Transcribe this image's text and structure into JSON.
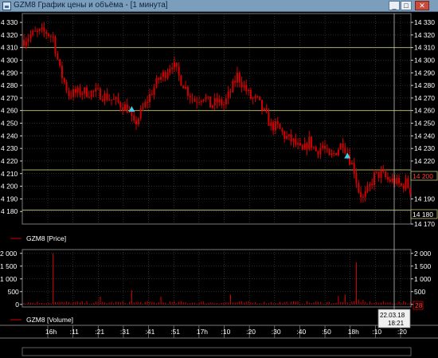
{
  "window": {
    "title": "GZM8 График цены и объёма - [1 минута]",
    "controls": {
      "minimize": "_",
      "maximize": "□",
      "close": "✕"
    }
  },
  "colors": {
    "background": "#000000",
    "candle": "#d40000",
    "grid": "#5a5a5a",
    "level_line": "#c8c878",
    "crosshair": "#c0c0c0",
    "marker": "#3cd0e6",
    "price_box_text": "#ff3a3a"
  },
  "price_panel": {
    "legend": "GZM8 [Price]",
    "left_ticks": [
      "4 330",
      "4 320",
      "4 310",
      "4 300",
      "4 290",
      "4 280",
      "4 270",
      "4 260",
      "4 250",
      "4 240",
      "4 230",
      "4 220",
      "4 210",
      "4 200",
      "4 190",
      "4 180"
    ],
    "right_ticks": [
      "14 330",
      "14 320",
      "14 310",
      "14 300",
      "14 290",
      "14 280",
      "14 270",
      "14 260",
      "14 250",
      "14 240",
      "14 230",
      "14 220",
      "14 210",
      "14 190",
      "14 170"
    ],
    "current_price_label": "14 200",
    "level_label": "14 180"
  },
  "volume_panel": {
    "legend": "GZM8 [Volume]",
    "left_ticks": [
      "2 000",
      "1 500",
      "1 000",
      "500",
      "0"
    ],
    "right_ticks": [
      "2 000",
      "1 500",
      "1 000",
      "500",
      "0"
    ],
    "current_volume_label": "28"
  },
  "time_axis": {
    "labels": [
      "16h",
      ":11",
      ":21",
      ":31",
      ":41",
      ":51",
      "17h",
      ":10",
      ":20",
      ":30",
      ":40",
      ":50",
      "18h",
      ":10",
      ":20"
    ],
    "crosshair_date": "22.03.18",
    "crosshair_time": "18:21"
  },
  "chart_data": [
    {
      "type": "candlestick",
      "series": [
        {
          "name": "GZM8 [Price]"
        }
      ],
      "price_path": [
        [
          0,
          4316
        ],
        [
          3,
          4320
        ],
        [
          7,
          4322
        ],
        [
          10,
          4322
        ],
        [
          13,
          4318
        ],
        [
          16,
          4292
        ],
        [
          20,
          4273
        ],
        [
          26,
          4275
        ],
        [
          33,
          4274
        ],
        [
          40,
          4268
        ],
        [
          46,
          4262
        ],
        [
          49,
          4248
        ],
        [
          52,
          4258
        ],
        [
          56,
          4272
        ],
        [
          60,
          4285
        ],
        [
          63,
          4290
        ],
        [
          66,
          4298
        ],
        [
          69,
          4287
        ],
        [
          73,
          4275
        ],
        [
          76,
          4268
        ],
        [
          80,
          4272
        ],
        [
          83,
          4264
        ],
        [
          86,
          4267
        ],
        [
          89,
          4265
        ],
        [
          92,
          4275
        ],
        [
          95,
          4288
        ],
        [
          98,
          4279
        ],
        [
          101,
          4270
        ],
        [
          104,
          4268
        ],
        [
          107,
          4258
        ],
        [
          110,
          4248
        ],
        [
          113,
          4247
        ],
        [
          116,
          4240
        ],
        [
          120,
          4235
        ],
        [
          124,
          4227
        ],
        [
          127,
          4236
        ],
        [
          130,
          4228
        ],
        [
          133,
          4232
        ],
        [
          136,
          4222
        ],
        [
          139,
          4228
        ],
        [
          142,
          4235
        ],
        [
          144,
          4226
        ],
        [
          147,
          4213
        ],
        [
          149,
          4197
        ],
        [
          151,
          4190
        ],
        [
          153,
          4196
        ],
        [
          156,
          4208
        ],
        [
          159,
          4210
        ],
        [
          162,
          4205
        ],
        [
          165,
          4204
        ],
        [
          168,
          4200
        ],
        [
          170,
          4203
        ],
        [
          172,
          4197
        ]
      ],
      "markers": [
        {
          "x": 48,
          "price": 4261,
          "shape": "triangle"
        },
        {
          "x": 144,
          "price": 4224,
          "shape": "triangle"
        }
      ],
      "level_lines": [
        4310,
        4260,
        4213,
        4181
      ],
      "ylim": [
        4170,
        4337
      ]
    },
    {
      "type": "bar",
      "series": [
        {
          "name": "GZM8 [Volume]"
        }
      ],
      "spikes": [
        {
          "x": 13,
          "value": 2000
        },
        {
          "x": 34,
          "value": 310
        },
        {
          "x": 48,
          "value": 560
        },
        {
          "x": 61,
          "value": 310
        },
        {
          "x": 92,
          "value": 390
        },
        {
          "x": 140,
          "value": 330
        },
        {
          "x": 143,
          "value": 390
        },
        {
          "x": 148,
          "value": 1650
        },
        {
          "x": 149,
          "value": 200
        },
        {
          "x": 151,
          "value": 180
        }
      ],
      "ylim": [
        -100,
        2150
      ]
    }
  ]
}
